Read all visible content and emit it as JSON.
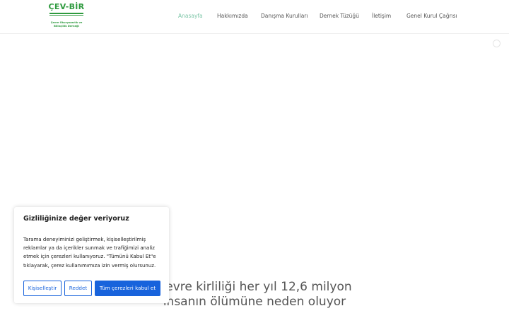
{
  "header": {
    "logo": {
      "title": "ÇEV-BİR",
      "subtitle_line1": "Çevre Okuryazarlık ve",
      "subtitle_line2": "Bilinçlilik Derneği"
    },
    "nav": [
      {
        "label": "Anasayfa",
        "active": true
      },
      {
        "label": "Hakkımızda",
        "active": false
      },
      {
        "label": "Danışma Kurulları",
        "active": false
      },
      {
        "label": "Dernek Tüzüğü",
        "active": false
      },
      {
        "label": "İletişim",
        "active": false
      },
      {
        "label": "Genel Kurul Çağrısı",
        "active": false
      }
    ]
  },
  "hero": {
    "line1": "Çevre kirliliği her yıl 12,6 milyon",
    "line2": "insanın ölümüne neden oluyor"
  },
  "cookie_banner": {
    "title": "Gizliliğinize değer veriyoruz",
    "text": "Tarama deneyiminizi geliştirmek, kişiselleştirilmiş reklamlar ya da içerikler sunmak ve trafiğimizi analiz etmek için çerezleri kullanıyoruz. \"Tümünü Kabul Et\"e tıklayarak, çerez kullanımımıza izin vermiş olursunuz.",
    "customize_label": "Kişiselleştir",
    "reject_label": "Reddet",
    "accept_label": "Tüm çerezleri kabul et"
  },
  "colors": {
    "brand_green": "#2e9a3e",
    "nav_active": "#7dc6a8",
    "button_blue": "#1863dc"
  }
}
